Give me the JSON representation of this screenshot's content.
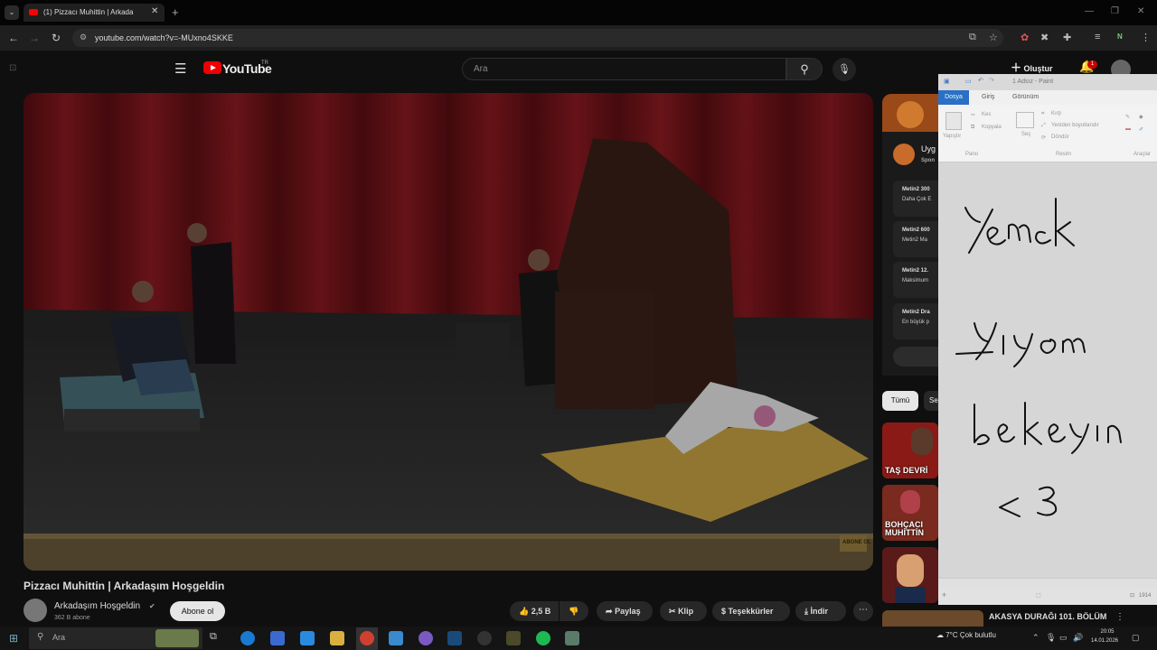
{
  "browser": {
    "tab_title": "(1) Pizzacı Muhittin | Arkada",
    "tab_close": "✕",
    "new_tab": "+",
    "url": "youtube.com/watch?v=-MUxno4SKKE",
    "profile_initial": "N",
    "ext_badge": "3"
  },
  "youtube": {
    "logo": "YouTube",
    "logo_region": "TR",
    "search_placeholder": "Ara",
    "create_label": "Oluştur",
    "notif_count": "1"
  },
  "video": {
    "title": "Pizzacı Muhittin | Arkadaşım Hoşgeldin",
    "watermark": "ABONE OL",
    "channel_name": "Arkadaşım Hoşgeldin",
    "channel_subs": "362 B abone",
    "subscribe_label": "Abone ol",
    "like_count": "2,5 B",
    "share_label": "Paylaş",
    "clip_label": "Klip",
    "thanks_label": "Teşekkürler",
    "download_label": "İndir"
  },
  "sidebar": {
    "ad_name": "Uyg",
    "ad_sponsor": "Spon",
    "ad_items": [
      {
        "l1": "Metin2 300",
        "l2": "Daha Çok E"
      },
      {
        "l1": "Metin2 600",
        "l2": "Metin2 Ma"
      },
      {
        "l1": "Metin2 12.",
        "l2": "Maksimum"
      },
      {
        "l1": "Metin2 Dra",
        "l2": "En büyük p"
      }
    ],
    "chip_all": "Tümü",
    "chip_next": "Se",
    "thumbs": [
      {
        "label": "TAŞ DEVRİ"
      },
      {
        "label": "BOHÇACI MUHİTTİN"
      },
      {
        "label": ""
      }
    ],
    "bottom_title": "AKASYA DURAĞI 101. BÖLÜM"
  },
  "paint": {
    "title": "1 Adsız - Paint",
    "tabs": [
      "Dosya",
      "Giriş",
      "Görünüm"
    ],
    "ribbon": {
      "paste": "Yapıştır",
      "cut": "Kes",
      "copy": "Kopyala",
      "select": "Seç",
      "crop": "Kırp",
      "resize": "Yeniden boyutlandır",
      "rotate": "Döndür",
      "group_clipboard": "Pano",
      "group_image": "Resim",
      "group_tools": "Araçlar"
    },
    "handwriting": [
      "Yemek",
      "Yiyom",
      "bekleyin",
      "<3"
    ],
    "status_size": "1914"
  },
  "taskbar": {
    "search_placeholder": "Ara",
    "weather": "7°C  Çok bulutlu",
    "time": "20:05",
    "date": "14.01.2026"
  }
}
